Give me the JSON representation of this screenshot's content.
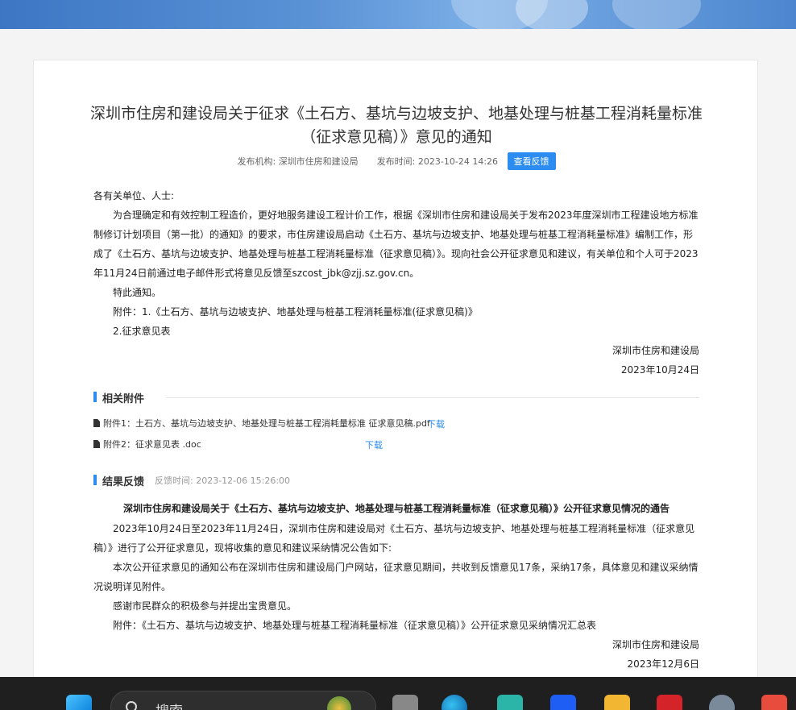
{
  "article": {
    "title_line1": "深圳市住房和建设局关于征求《土石方、基坑与边坡支护、地基处理与桩基工程消耗量标准",
    "title_line2": "（征求意见稿）》意见的通知",
    "publisher_label": "发布机构:",
    "publisher": "深圳市住房和建设局",
    "time_label": "发布时间:",
    "time": "2023-10-24 14:26",
    "feedback_button": "查看反馈",
    "salutation": "各有关单位、人士:",
    "para1": "为合理确定和有效控制工程造价，更好地服务建设工程计价工作，根据《深圳市住房和建设局关于发布2023年度深圳市工程建设地方标准制修订计划项目（第一批）的通知》的要求，市住房建设局启动《土石方、基坑与边坡支护、地基处理与桩基工程消耗量标准》编制工作，形成了《土石方、基坑与边坡支护、地基处理与桩基工程消耗量标准（征求意见稿）》。现向社会公开征求意见和建议，有关单位和个人可于2023年11月24日前通过电子邮件形式将意见反馈至szcost_jbk@zjj.sz.gov.cn。",
    "para2": "特此通知。",
    "para3": "附件：1.《土石方、基坑与边坡支护、地基处理与桩基工程消耗量标准(征求意见稿)》",
    "para4": "2.征求意见表",
    "sign_org": "深圳市住房和建设局",
    "sign_date": "2023年10月24日"
  },
  "attachments": {
    "heading": "相关附件",
    "items": [
      {
        "label": "附件1：土石方、基坑与边坡支护、地基处理与桩基工程消耗量标准 征求意见稿.pdf",
        "download": "下载"
      },
      {
        "label": "附件2：征求意见表 .doc",
        "download": "下载"
      }
    ]
  },
  "result": {
    "heading": "结果反馈",
    "time_label": "反馈时间:",
    "time": "2023-12-06 15:26:00",
    "notice_title": "深圳市住房和建设局关于《土石方、基坑与边坡支护、地基处理与桩基工程消耗量标准（征求意见稿）》公开征求意见情况的通告",
    "para1": "2023年10月24日至2023年11月24日，深圳市住房和建设局对《土石方、基坑与边坡支护、地基处理与桩基工程消耗量标准（征求意见稿）》进行了公开征求意见，现将收集的意见和建议采纳情况公告如下:",
    "para2": "本次公开征求意见的通知公布在深圳市住房和建设局门户网站，征求意见期间，共收到反馈意见17条，采纳17条，具体意见和建议采纳情况说明详见附件。",
    "para3": "感谢市民群众的积极参与并提出宝贵意见。",
    "para4": "附件：《土石方、基坑与边坡支护、地基处理与桩基工程消耗量标准（征求意见稿）》公开征求意见采纳情况汇总表",
    "sign_org": "深圳市住房和建设局",
    "sign_date": "2023年12月6日"
  },
  "taskbar": {
    "search_text": "搜索"
  }
}
